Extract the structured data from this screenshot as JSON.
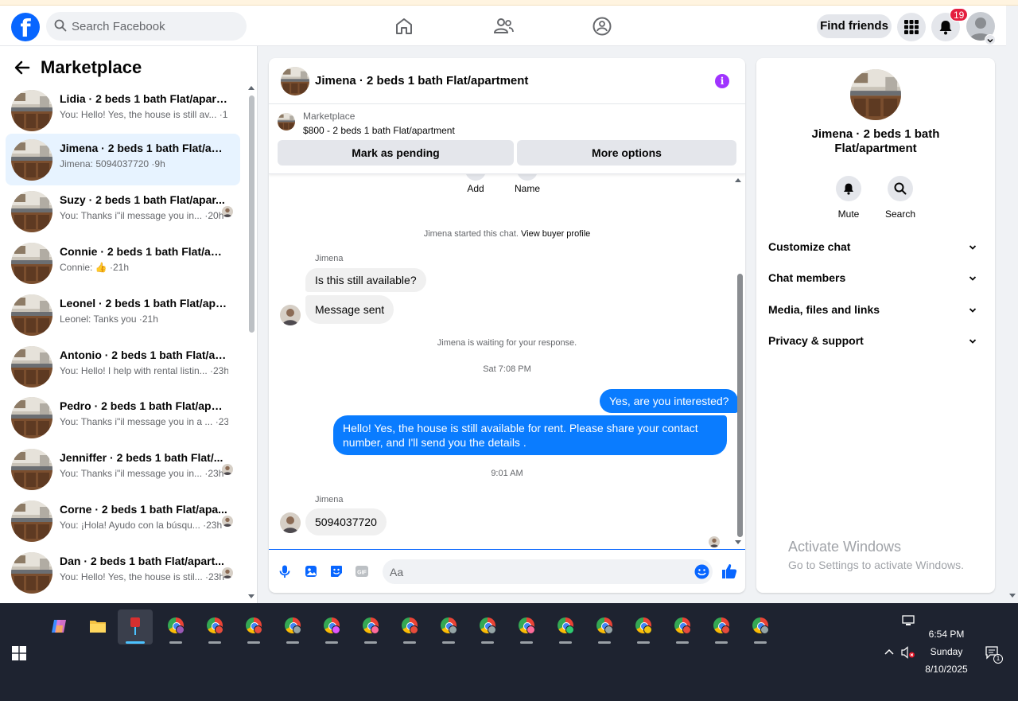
{
  "header": {
    "search_placeholder": "Search Facebook",
    "find_friends": "Find friends",
    "notification_count": "19"
  },
  "sidebar": {
    "title": "Marketplace",
    "conversations": [
      {
        "name": "Lidia · 2 beds 1 bath Flat/apartm...",
        "preview": "You: Hello! Yes, the house is still av... ·1m"
      },
      {
        "name": "Jimena · 2 beds 1 bath Flat/apar...",
        "preview": "Jimena: 5094037720 ·9h"
      },
      {
        "name": "Suzy · 2 beds 1 bath Flat/apar...",
        "preview": "You: Thanks i\"il message you in... ·20h"
      },
      {
        "name": "Connie · 2 beds 1 bath Flat/apar...",
        "preview": "Connie: 👍 ·21h"
      },
      {
        "name": "Leonel · 2 beds 1 bath Flat/apart...",
        "preview": "Leonel: Tanks you ·21h"
      },
      {
        "name": "Antonio · 2 beds 1 bath Flat/apa...",
        "preview": "You: Hello! I help with rental listin... ·23h"
      },
      {
        "name": "Pedro · 2 beds 1 bath Flat/apart...",
        "preview": "You: Thanks i\"il message you in a ... ·23h"
      },
      {
        "name": "Jenniffer · 2 beds 1 bath Flat/...",
        "preview": "You: Thanks i\"il message you in... ·23h"
      },
      {
        "name": "Corne · 2 beds 1 bath Flat/apa...",
        "preview": "You: ¡Hola! Ayudo con la búsqu... ·23h"
      },
      {
        "name": "Dan · 2 beds 1 bath Flat/apart...",
        "preview": "You: Hello! Yes, the house is stil... ·23h"
      }
    ]
  },
  "chat": {
    "title": "Jimena · 2 beds 1 bath Flat/apartment",
    "listing_source": "Marketplace",
    "listing_price": "$800 - 2 beds 1 bath Flat/apartment",
    "mark_pending": "Mark as pending",
    "more_options": "More options",
    "action_add": "Add",
    "action_name": "Name",
    "started_text": "Jimena started this chat.",
    "view_profile": "View buyer profile",
    "sender_name": "Jimena",
    "msg1": "Is this still available?",
    "msg2": "Message sent",
    "waiting_text": "Jimena is waiting for your response.",
    "time1": "Sat 7:08 PM",
    "out1": "Yes, are you interested?",
    "out2": "Hello! Yes, the house is still available for rent. Please share your contact number, and I'll send you the details .",
    "time2": "9:01 AM",
    "msg3": "5094037720",
    "compose_placeholder": "Aa"
  },
  "info_panel": {
    "name": "Jimena · 2 beds 1 bath Flat/apartment",
    "mute": "Mute",
    "search": "Search",
    "sections": [
      "Customize chat",
      "Chat members",
      "Media, files and links",
      "Privacy & support"
    ]
  },
  "watermark": {
    "line1": "Activate Windows",
    "line2": "Go to Settings to activate Windows."
  },
  "taskbar": {
    "time": "6:54 PM",
    "day": "Sunday",
    "date": "8/10/2025",
    "notification_count": "1"
  },
  "colors": {
    "brand": "#0866ff",
    "bubble_out": "#0a7cff",
    "info_icon": "#a033ff",
    "badge": "#e41e3f"
  }
}
